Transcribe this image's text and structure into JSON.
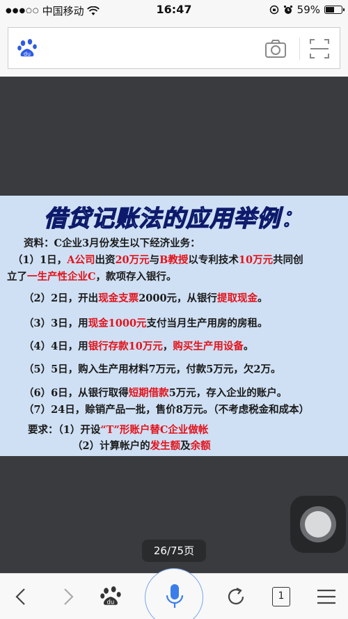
{
  "status_bar": {
    "carrier": "中国移动",
    "time": "16:47",
    "battery_percent": "59%",
    "battery_level": 0.59,
    "signal_strength": "●●●○○"
  },
  "search_bar": {
    "logo_icon": "baidu-paw-icon",
    "camera_icon": "camera-icon",
    "scan_icon": "scan-icon"
  },
  "slide": {
    "title": "借贷记账法的应用举例：",
    "lines": [
      {
        "segments": [
          {
            "t": "资料：C企业3月份发生以下经济业务：",
            "r": false
          }
        ]
      },
      {
        "segments": [
          {
            "t": "（1）1日，",
            "r": false
          },
          {
            "t": "A公司",
            "r": true
          },
          {
            "t": "出资",
            "r": false
          },
          {
            "t": "20万元",
            "r": true
          },
          {
            "t": "与",
            "r": false
          },
          {
            "t": "B教授",
            "r": true
          },
          {
            "t": "以专利技术",
            "r": false
          },
          {
            "t": "10万元",
            "r": true
          },
          {
            "t": "共同创",
            "r": false
          }
        ]
      },
      {
        "segments": [
          {
            "t": "立了",
            "r": false
          },
          {
            "t": "一生产性企业C",
            "r": true
          },
          {
            "t": "，款项存入银行。",
            "r": false
          }
        ]
      },
      {
        "segments": [
          {
            "t": "（2）2日，开出",
            "r": false
          },
          {
            "t": "现金支票",
            "r": true
          },
          {
            "t": "2000元，从银行",
            "r": false
          },
          {
            "t": "提取现金",
            "r": true
          },
          {
            "t": "。",
            "r": false
          }
        ]
      },
      {
        "segments": [
          {
            "t": "（3）3日，用",
            "r": false
          },
          {
            "t": "现金1000元",
            "r": true
          },
          {
            "t": "支付当月生产用房的房租。",
            "r": false
          }
        ]
      },
      {
        "segments": [
          {
            "t": "（4）4日，用",
            "r": false
          },
          {
            "t": "银行存款10万元",
            "r": true
          },
          {
            "t": "，",
            "r": false
          },
          {
            "t": "购买生产用设备",
            "r": true
          },
          {
            "t": "。",
            "r": false
          }
        ]
      },
      {
        "segments": [
          {
            "t": "（5）5日，购入生产用材料7万元，付款5万元，欠2万。",
            "r": false
          }
        ]
      },
      {
        "segments": [
          {
            "t": "（6）6日，从银行取得",
            "r": false
          },
          {
            "t": "短期借款",
            "r": true
          },
          {
            "t": "5万元，存入企业的账户。",
            "r": false
          }
        ]
      },
      {
        "segments": [
          {
            "t": "（7）24日，赊销产品一批，售价8万元。（不考虑税金和成本）",
            "r": false
          }
        ]
      },
      {
        "segments": [
          {
            "t": "要求：（1）开设",
            "r": false
          },
          {
            "t": "“T”形账户替C企业做帐",
            "r": true
          }
        ]
      },
      {
        "segments": [
          {
            "t": "（2）计算帐户的",
            "r": false
          },
          {
            "t": "发生额",
            "r": true
          },
          {
            "t": "及",
            "r": false
          },
          {
            "t": "余额",
            "r": true
          }
        ]
      }
    ]
  },
  "pager": {
    "label": "26/75页"
  },
  "toolbar": {
    "back_icon": "chevron-left-icon",
    "forward_icon": "chevron-right-icon",
    "home_icon": "baidu-paw-icon",
    "mic_icon": "microphone-icon",
    "refresh_icon": "refresh-icon",
    "tab_count": "1",
    "menu_icon": "menu-icon"
  },
  "colors": {
    "accent": "#3b7de9",
    "highlight": "#e2131b",
    "slide_bg": "#cfe0f4"
  }
}
